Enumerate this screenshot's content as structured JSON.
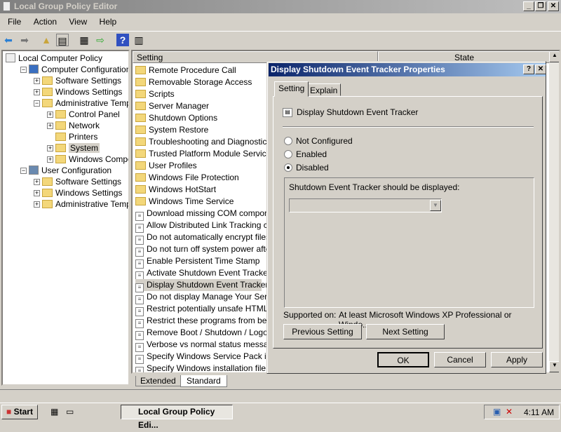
{
  "window": {
    "title": "Local Group Policy Editor"
  },
  "menu": [
    "File",
    "Action",
    "View",
    "Help"
  ],
  "tree": [
    {
      "label": "Local Computer Policy",
      "level": 0,
      "expander": "",
      "icon": "policy-icon"
    },
    {
      "label": "Computer Configuration",
      "level": 1,
      "expander": "-",
      "icon": "computer-icon"
    },
    {
      "label": "Software Settings",
      "level": 2,
      "expander": "+",
      "icon": "folder-icon"
    },
    {
      "label": "Windows Settings",
      "level": 2,
      "expander": "+",
      "icon": "folder-icon"
    },
    {
      "label": "Administrative Templates",
      "level": 2,
      "expander": "-",
      "icon": "folder-icon"
    },
    {
      "label": "Control Panel",
      "level": 3,
      "expander": "+",
      "icon": "folder-icon"
    },
    {
      "label": "Network",
      "level": 3,
      "expander": "+",
      "icon": "folder-icon"
    },
    {
      "label": "Printers",
      "level": 3,
      "expander": "",
      "icon": "folder-icon"
    },
    {
      "label": "System",
      "level": 3,
      "expander": "+",
      "icon": "folder-icon",
      "selected": true
    },
    {
      "label": "Windows Components",
      "level": 3,
      "expander": "+",
      "icon": "folder-icon"
    },
    {
      "label": "User Configuration",
      "level": 1,
      "expander": "-",
      "icon": "user-icon"
    },
    {
      "label": "Software Settings",
      "level": 2,
      "expander": "+",
      "icon": "folder-icon"
    },
    {
      "label": "Windows Settings",
      "level": 2,
      "expander": "+",
      "icon": "folder-icon"
    },
    {
      "label": "Administrative Templates",
      "level": 2,
      "expander": "+",
      "icon": "folder-icon"
    }
  ],
  "list": {
    "columns": [
      "Setting",
      "State"
    ],
    "rows": [
      {
        "label": "Remote Procedure Call",
        "type": "folder"
      },
      {
        "label": "Removable Storage Access",
        "type": "folder"
      },
      {
        "label": "Scripts",
        "type": "folder"
      },
      {
        "label": "Server Manager",
        "type": "folder"
      },
      {
        "label": "Shutdown Options",
        "type": "folder"
      },
      {
        "label": "System Restore",
        "type": "folder"
      },
      {
        "label": "Troubleshooting and Diagnostics",
        "type": "folder"
      },
      {
        "label": "Trusted Platform Module Services",
        "type": "folder"
      },
      {
        "label": "User Profiles",
        "type": "folder"
      },
      {
        "label": "Windows File Protection",
        "type": "folder"
      },
      {
        "label": "Windows HotStart",
        "type": "folder"
      },
      {
        "label": "Windows Time Service",
        "type": "folder"
      },
      {
        "label": "Download missing COM components",
        "type": "policy"
      },
      {
        "label": "Allow Distributed Link Tracking clien",
        "type": "policy"
      },
      {
        "label": "Do not automatically encrypt files m",
        "type": "policy"
      },
      {
        "label": "Do not turn off system power after",
        "type": "policy"
      },
      {
        "label": "Enable Persistent Time Stamp",
        "type": "policy"
      },
      {
        "label": "Activate Shutdown Event Tracker S",
        "type": "policy"
      },
      {
        "label": "Display Shutdown Event Tracker",
        "type": "policy",
        "selected": true
      },
      {
        "label": "Do not display Manage Your Server",
        "type": "policy"
      },
      {
        "label": "Restrict potentially unsafe HTML He",
        "type": "policy"
      },
      {
        "label": "Restrict these programs from being",
        "type": "policy"
      },
      {
        "label": "Remove Boot / Shutdown / Logon /",
        "type": "policy"
      },
      {
        "label": "Verbose vs normal status messages",
        "type": "policy"
      },
      {
        "label": "Specify Windows Service Pack insta",
        "type": "policy"
      },
      {
        "label": "Specify Windows installation file loc",
        "type": "policy"
      }
    ],
    "tabs": [
      "Extended",
      "Standard"
    ],
    "active_tab": "Standard"
  },
  "dialog": {
    "title": "Display Shutdown Event Tracker Properties",
    "tabs": [
      "Setting",
      "Explain"
    ],
    "active_tab": "Setting",
    "policy_name": "Display Shutdown Event Tracker",
    "options": [
      "Not Configured",
      "Enabled",
      "Disabled"
    ],
    "selected_option": "Disabled",
    "options_label": "Shutdown Event Tracker should be displayed:",
    "dropdown_value": "",
    "supported_label": "Supported on:",
    "supported_value": "At least Microsoft Windows XP Professional or Windo...",
    "prev_button": "Previous Setting",
    "next_button": "Next Setting",
    "ok": "OK",
    "cancel": "Cancel",
    "apply": "Apply"
  },
  "taskbar": {
    "start": "Start",
    "task": "Local Group Policy Edi...",
    "clock": "4:11 AM"
  },
  "colors": {
    "dialog_title": "#0a246a",
    "face": "#d4d0c8"
  }
}
